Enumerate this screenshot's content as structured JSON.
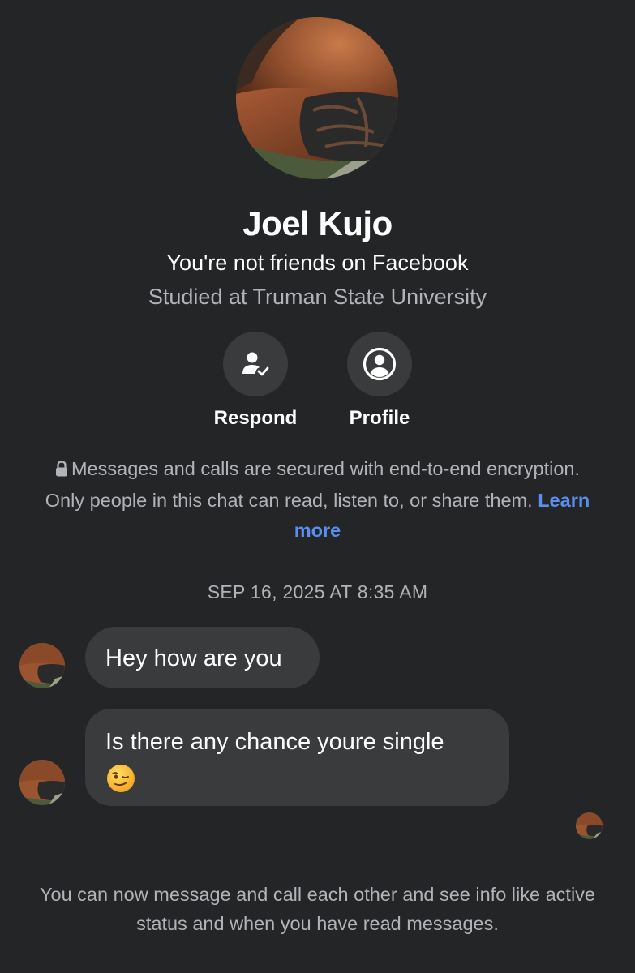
{
  "contact": {
    "name": "Joel Kujo",
    "friend_status": "You're not friends on Facebook",
    "education": "Studied at Truman State University"
  },
  "actions": [
    {
      "label": "Respond",
      "icon": "person-check-icon"
    },
    {
      "label": "Profile",
      "icon": "profile-circle-icon"
    }
  ],
  "encryption": {
    "icon": "lock-icon",
    "text": "Messages and calls are secured with end-to-end encryption. Only people in this chat can read, listen to, or share them.",
    "link_label": "Learn more",
    "link_color": "#5a8ff0"
  },
  "chat": {
    "timestamp": "SEP 16, 2025 AT 8:35 AM",
    "messages": [
      {
        "text": "Hey how are you",
        "emoji": ""
      },
      {
        "text": "Is there any chance youre single",
        "emoji": "winking-face-emoji"
      }
    ]
  },
  "footer_note": "You can now message and call each other and see info like active status and when you have read messages.",
  "colors": {
    "background": "#242526",
    "bubble": "#3a3b3c",
    "secondary_text": "#b0b3b8",
    "accent": "#5a8ff0"
  }
}
